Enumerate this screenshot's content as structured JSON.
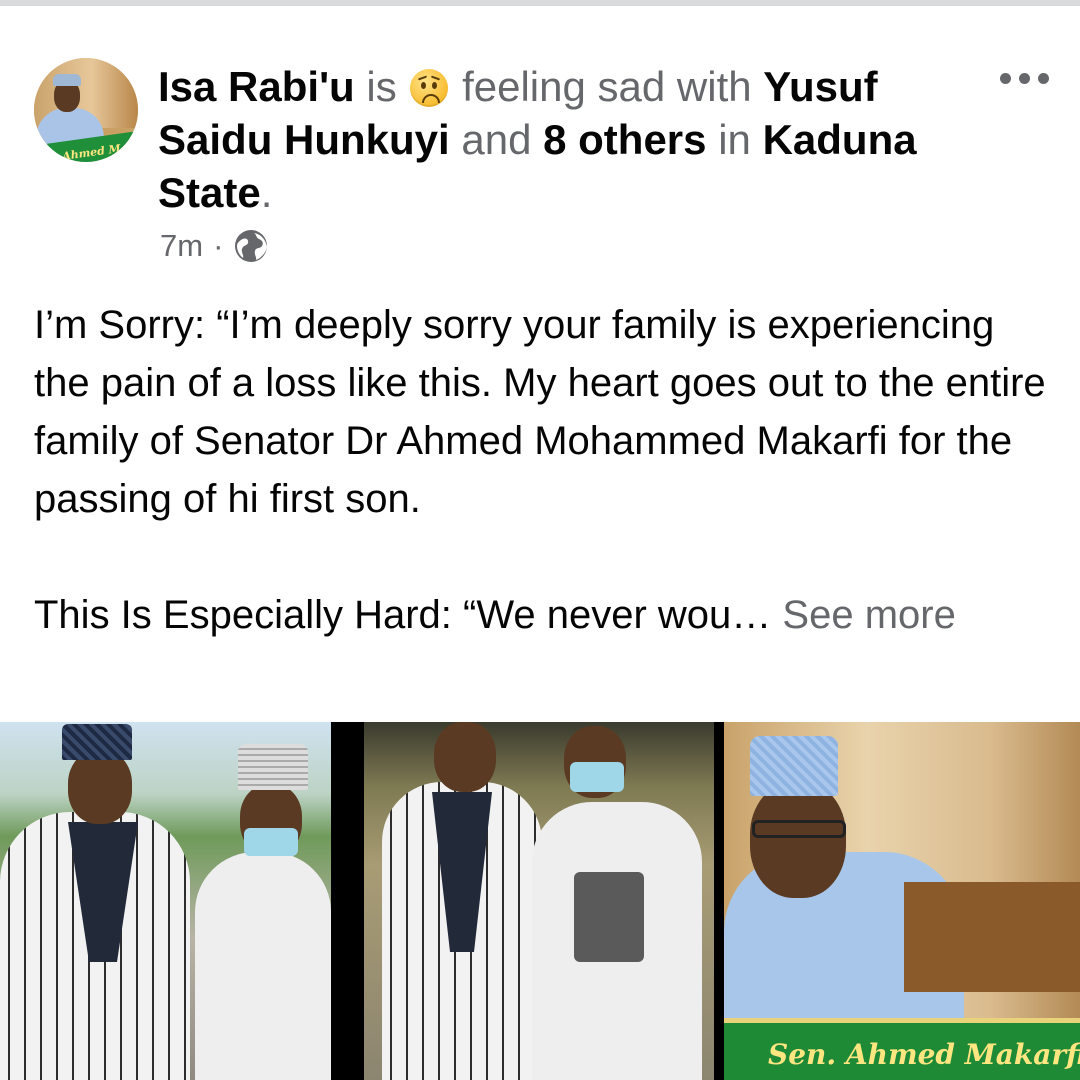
{
  "post": {
    "author": "Isa Rabi'u",
    "is_word": "is",
    "feeling": "feeling sad",
    "with_word": "with",
    "tagged": "Yusuf Saidu Hunkuyi",
    "and_word": "and",
    "others": "8 others",
    "in_word": "in",
    "location": "Kaduna State",
    "period": ".",
    "timestamp": "7m",
    "separator": "·",
    "privacy_icon": "globe-icon",
    "more_icon": "more-horizontal-icon",
    "feeling_emoji": "sad-face-emoji-icon",
    "avatar_banner_text": "Ahmed M",
    "paragraph1": "I’m Sorry: “I’m deeply sorry your family is experiencing the pain of a loss like this. My heart goes out to the entire family of Senator Dr Ahmed Mohammed Makarfi for the passing of hi first son.",
    "paragraph2": "This Is Especially Hard: “We never wou…",
    "see_more": "See more"
  },
  "photos": {
    "photo3_banner": "Sen. Ahmed Makarfi"
  },
  "colors": {
    "primary_text": "#050505",
    "secondary_text": "#65676b",
    "banner_green": "#1f8a36",
    "banner_text": "#ffe680"
  }
}
